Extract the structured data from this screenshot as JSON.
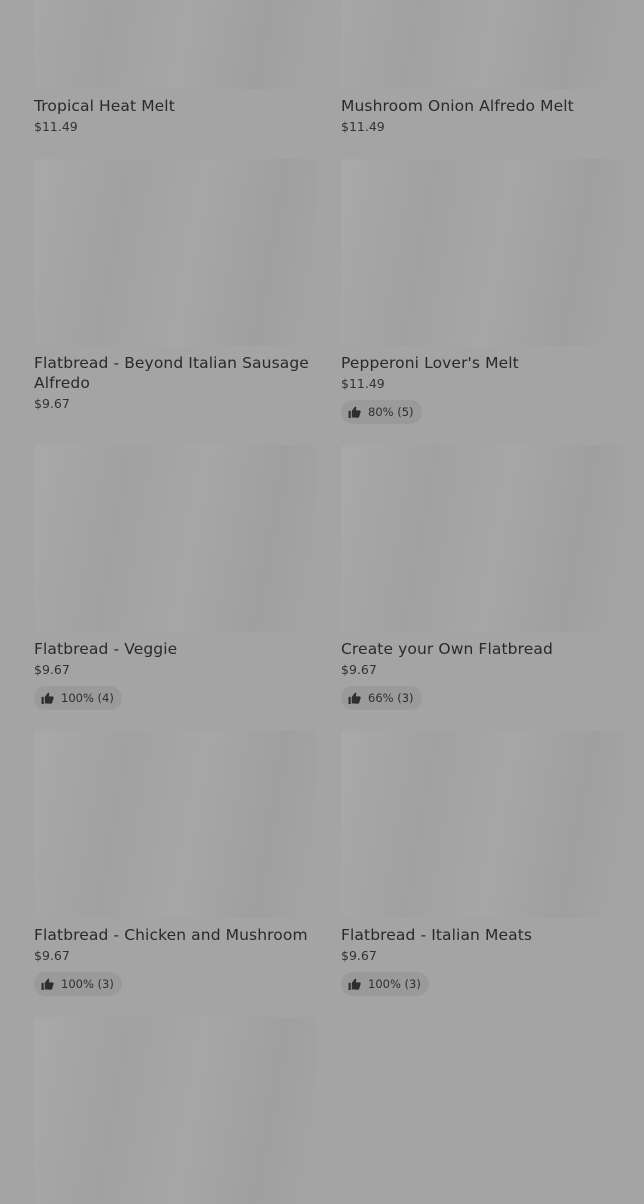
{
  "items": [
    {
      "name": "Tropical Heat Melt",
      "price": "$11.49"
    },
    {
      "name": "Mushroom Onion Alfredo Melt",
      "price": "$11.49"
    },
    {
      "name": "Flatbread - Beyond Italian Sausage Alfredo",
      "price": "$9.67"
    },
    {
      "name": "Pepperoni Lover's Melt",
      "price": "$11.49",
      "rating": "80% (5)"
    },
    {
      "name": "Flatbread - Veggie",
      "price": "$9.67",
      "rating": "100% (4)"
    },
    {
      "name": "Create your Own Flatbread",
      "price": "$9.67",
      "rating": "66% (3)"
    },
    {
      "name": "Flatbread - Chicken and Mushroom",
      "price": "$9.67",
      "rating": "100% (3)"
    },
    {
      "name": "Flatbread - Italian Meats",
      "price": "$9.67",
      "rating": "100% (3)"
    }
  ],
  "icons": {
    "rating": "thumbs-up-icon"
  },
  "colors": {
    "overlay": "#a4a4a4",
    "text": "#2a2a2a"
  }
}
